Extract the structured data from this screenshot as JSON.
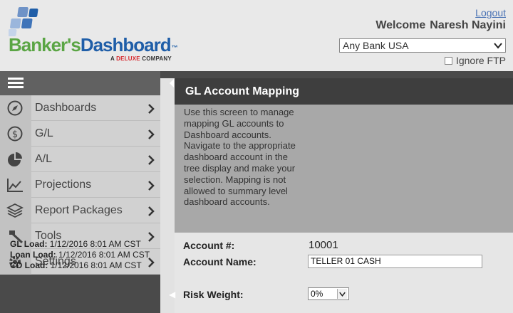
{
  "header": {
    "logo_part1": "Banker's",
    "logo_part2": "Dashboard",
    "trademark": "™",
    "tagline_prefix": "A",
    "tagline_brand": "DELUXE",
    "tagline_suffix": "COMPANY",
    "logout": "Logout",
    "welcome": "Welcome",
    "user_name": "Naresh Nayini",
    "bank_selected": "Any Bank USA",
    "ignore_ftp": "Ignore FTP"
  },
  "sidebar": {
    "items": [
      {
        "label": "Dashboards",
        "icon": "compass-icon"
      },
      {
        "label": "G/L",
        "icon": "dollar-icon"
      },
      {
        "label": "A/L",
        "icon": "pie-chart-icon"
      },
      {
        "label": "Projections",
        "icon": "line-chart-icon"
      },
      {
        "label": "Report Packages",
        "icon": "layers-icon"
      },
      {
        "label": "Tools",
        "icon": "hammer-icon"
      },
      {
        "label": "Settings",
        "icon": "gear-icon"
      }
    ],
    "loads": [
      {
        "label": "GL Load:",
        "value": "1/12/2016 8:01 AM CST"
      },
      {
        "label": "Loan Load:",
        "value": "1/12/2016 8:01 AM CST"
      },
      {
        "label": "CD Load:",
        "value": "1/12/2016 8:01 AM CST"
      }
    ]
  },
  "modal": {
    "title": "GL Account Mapping",
    "instructions": "Use this screen to manage mapping GL accounts to Dashboard accounts. Navigate to the appropriate dashboard account in the tree display and make your selection. Mapping is not allowed to summary level dashboard accounts.",
    "account_number_label": "Account #:",
    "account_number": "10001",
    "account_name_label": "Account Name:",
    "account_name": "TELLER 01 CASH",
    "risk_weight_label": "Risk Weight:",
    "risk_weight": "0%"
  },
  "colors": {
    "brand_green": "#5aa544",
    "brand_blue": "#1f5ea8",
    "deluxe_red": "#d6262b",
    "modal_header": "#3e3e3e"
  }
}
